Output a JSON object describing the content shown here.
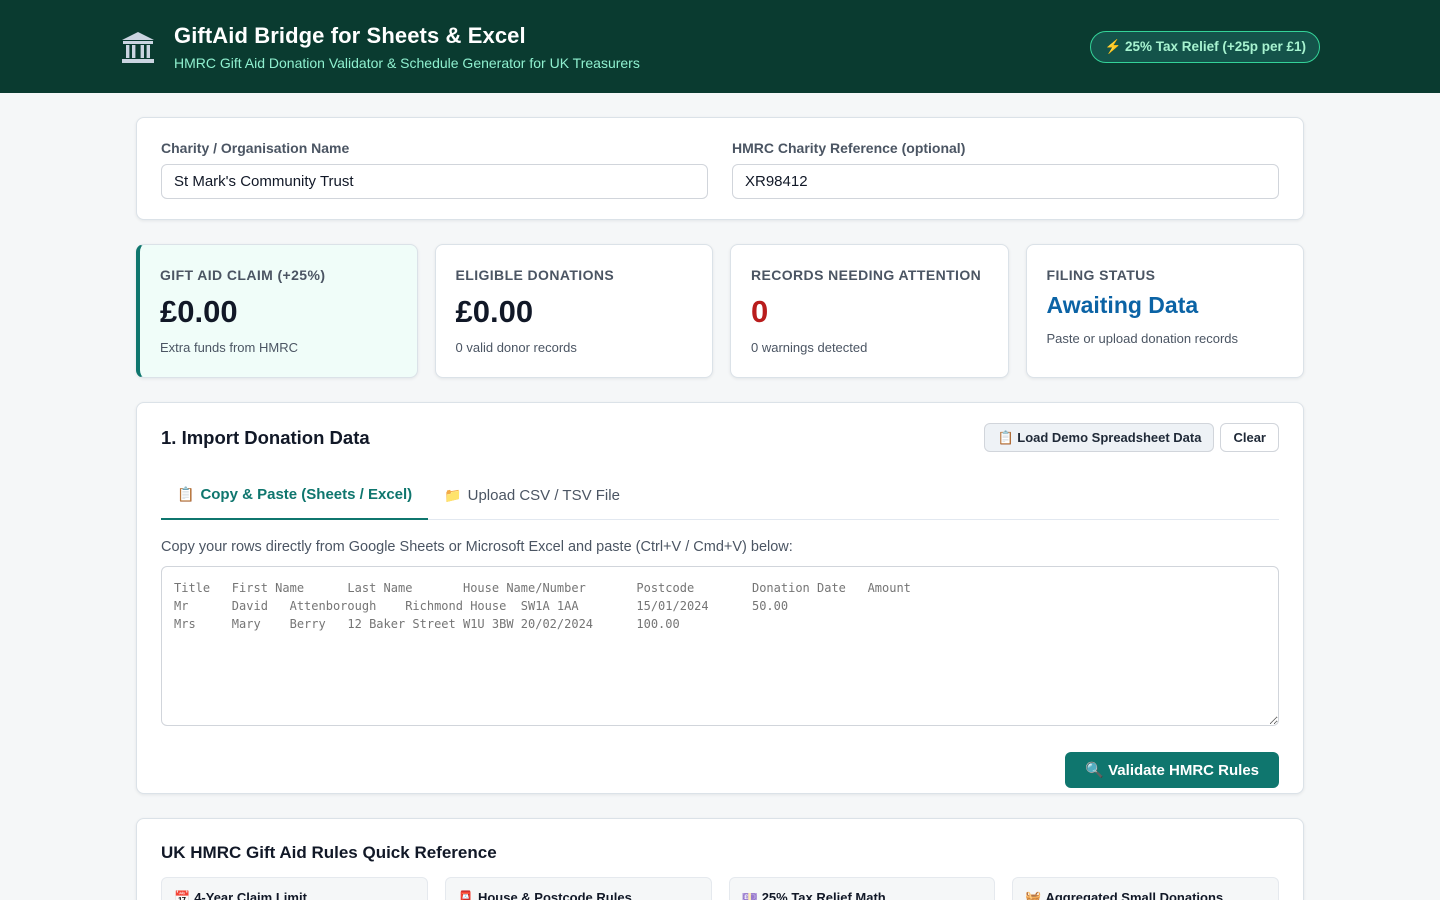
{
  "header": {
    "title": "GiftAid Bridge for Sheets & Excel",
    "subtitle": "HMRC Gift Aid Donation Validator & Schedule Generator for UK Treasurers",
    "badge": "⚡ 25% Tax Relief (+25p per £1)",
    "logo_icon": "bank-building-icon"
  },
  "org": {
    "name_label": "Charity / Organisation Name",
    "name_value": "St Mark's Community Trust",
    "ref_label": "HMRC Charity Reference (optional)",
    "ref_value": "XR98412"
  },
  "stats": [
    {
      "label": "Gift Aid Claim (+25%)",
      "value": "£0.00",
      "note": "Extra funds from HMRC"
    },
    {
      "label": "Eligible Donations",
      "value": "£0.00",
      "note": "0 valid donor records"
    },
    {
      "label": "Records Needing Attention",
      "value": "0",
      "note": "0 warnings detected"
    },
    {
      "label": "Filing Status",
      "value": "Awaiting Data",
      "note": "Paste or upload donation records"
    }
  ],
  "import": {
    "title": "1. Import Donation Data",
    "demo_button": "📋 Load Demo Spreadsheet Data",
    "clear_button": "Clear",
    "tabs": [
      {
        "icon": "📋",
        "label": "Copy & Paste (Sheets / Excel)"
      },
      {
        "icon": "📁",
        "label": "Upload CSV / TSV File"
      }
    ],
    "hint": "Copy your rows directly from Google Sheets or Microsoft Excel and paste (Ctrl+V / Cmd+V) below:",
    "placeholder": "Title\tFirst Name\tLast Name\tHouse Name/Number\tPostcode\tDonation Date\tAmount\nMr\tDavid\tAttenborough\tRichmond House\tSW1A 1AA\t15/01/2024\t50.00\nMrs\tMary\tBerry\t12 Baker Street\tW1U 3BW\t20/02/2024\t100.00",
    "validate_button": "🔍 Validate HMRC Rules"
  },
  "reference": {
    "title": "UK HMRC Gift Aid Rules Quick Reference",
    "items": [
      {
        "icon": "📅",
        "label": "4-Year Claim Limit"
      },
      {
        "icon": "📮",
        "label": "House & Postcode Rules"
      },
      {
        "icon": "💷",
        "label": "25% Tax Relief Math"
      },
      {
        "icon": "🧺",
        "label": "Aggregated Small Donations"
      }
    ]
  },
  "colors": {
    "header_bg": "#0a3b30",
    "accent": "#0f766e",
    "warning": "#b91c1c",
    "status_blue": "#0b63a5"
  }
}
